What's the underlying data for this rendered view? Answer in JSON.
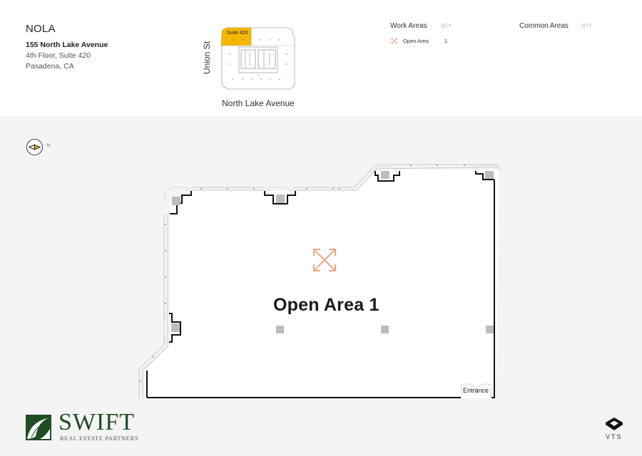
{
  "header": {
    "brand": "NOLA",
    "address_line1": "155 North Lake Avenue",
    "address_line2": "4th Floor, Suite 420",
    "address_line3": "Pasadena, CA"
  },
  "keymap": {
    "suite_label": "Suite 420",
    "street_side": "Union St",
    "street_front": "North Lake Avenue",
    "highlight_color": "#f5b800"
  },
  "legend": {
    "work_areas_title": "Work Areas",
    "common_areas_title": "Common Areas",
    "qty_label": "QTY",
    "work_items": [
      {
        "icon": "expand-arrows-icon",
        "label": "Open Area",
        "qty": "1",
        "color": "#f0a888"
      }
    ],
    "common_items": []
  },
  "compass": {
    "label": "N"
  },
  "floorplan": {
    "areas": [
      {
        "label": "Open Area 1",
        "icon": "expand-arrows-icon",
        "icon_color": "#f0a888"
      }
    ],
    "entrance_label": "Entrance"
  },
  "footer": {
    "company_name": "SWIFT",
    "company_tagline": "REAL ESTATE PARTNERS",
    "company_color": "#1f4e24",
    "platform": "VTS"
  }
}
